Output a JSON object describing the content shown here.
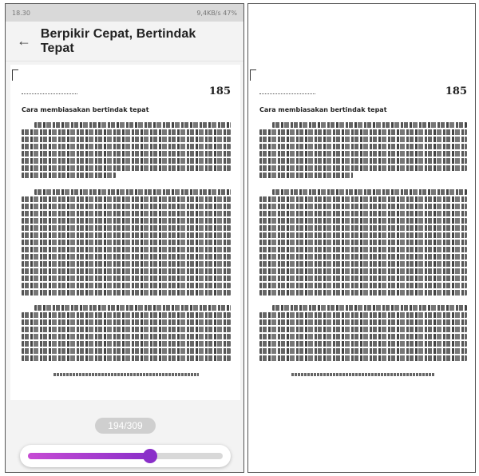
{
  "app": {
    "title": "Berpikir Cepat, Bertindak Tepat",
    "status_time": "18.30",
    "status_right": "9,4KB/s 47%"
  },
  "book_page": {
    "page_number": "185",
    "chapter_heading": "Cara membiasakan bertindak tepat",
    "paragraph_lines": [
      8,
      15,
      8
    ],
    "short_last_line": [
      true,
      false,
      false
    ]
  },
  "reader": {
    "page_label": "194/309",
    "current_page": 194,
    "total_pages": 309
  },
  "colors": {
    "accent": "#8a2fc9",
    "accent_light": "#c64bd4"
  },
  "icons": {
    "back": "arrow-left-icon"
  }
}
